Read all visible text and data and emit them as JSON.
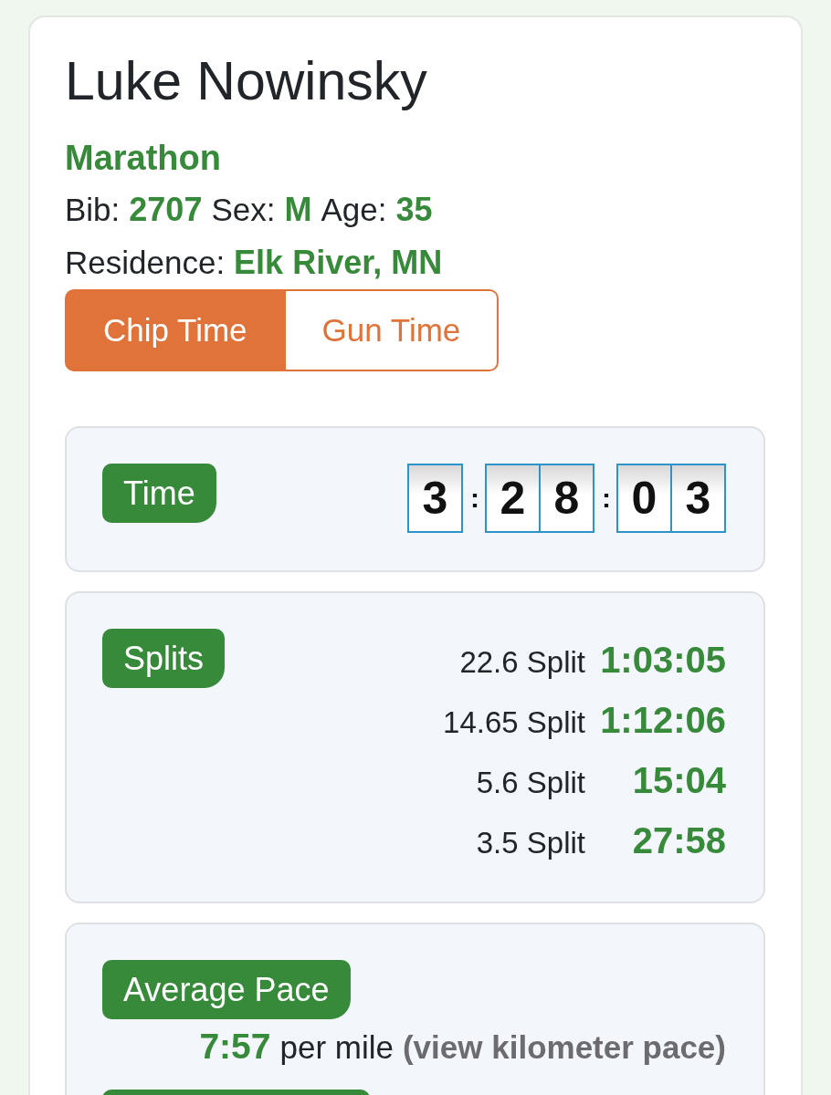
{
  "athlete": {
    "name": "Luke Nowinsky",
    "event": "Marathon",
    "details": [
      {
        "label": "Bib:",
        "value": "2707"
      },
      {
        "label": "Sex:",
        "value": "M"
      },
      {
        "label": "Age:",
        "value": "35"
      }
    ],
    "residence": {
      "label": "Residence:",
      "value": "Elk River, MN"
    }
  },
  "time_toggle": [
    {
      "label": "Chip Time",
      "selected": true
    },
    {
      "label": "Gun Time",
      "selected": false
    }
  ],
  "time_panel": {
    "badge": "Time",
    "clock": [
      {
        "kind": "digit",
        "text": "3"
      },
      {
        "kind": "separator",
        "text": ":"
      },
      {
        "kind": "digit",
        "text": "2"
      },
      {
        "kind": "digit",
        "text": "8"
      },
      {
        "kind": "separator",
        "text": ":"
      },
      {
        "kind": "digit",
        "text": "0"
      },
      {
        "kind": "digit",
        "text": "3"
      }
    ]
  },
  "splits_panel": {
    "badge": "Splits",
    "rows": [
      {
        "label": "22.6 Split",
        "time": "1:03:05"
      },
      {
        "label": "14.65 Split",
        "time": "1:12:06"
      },
      {
        "label": "5.6 Split",
        "time": "15:04"
      },
      {
        "label": "3.5 Split",
        "time": "27:58"
      }
    ]
  },
  "pace_panel": {
    "badge": "Average Pace",
    "value": "7:57",
    "unit": "per mile",
    "link": "(view kilometer pace)"
  }
}
